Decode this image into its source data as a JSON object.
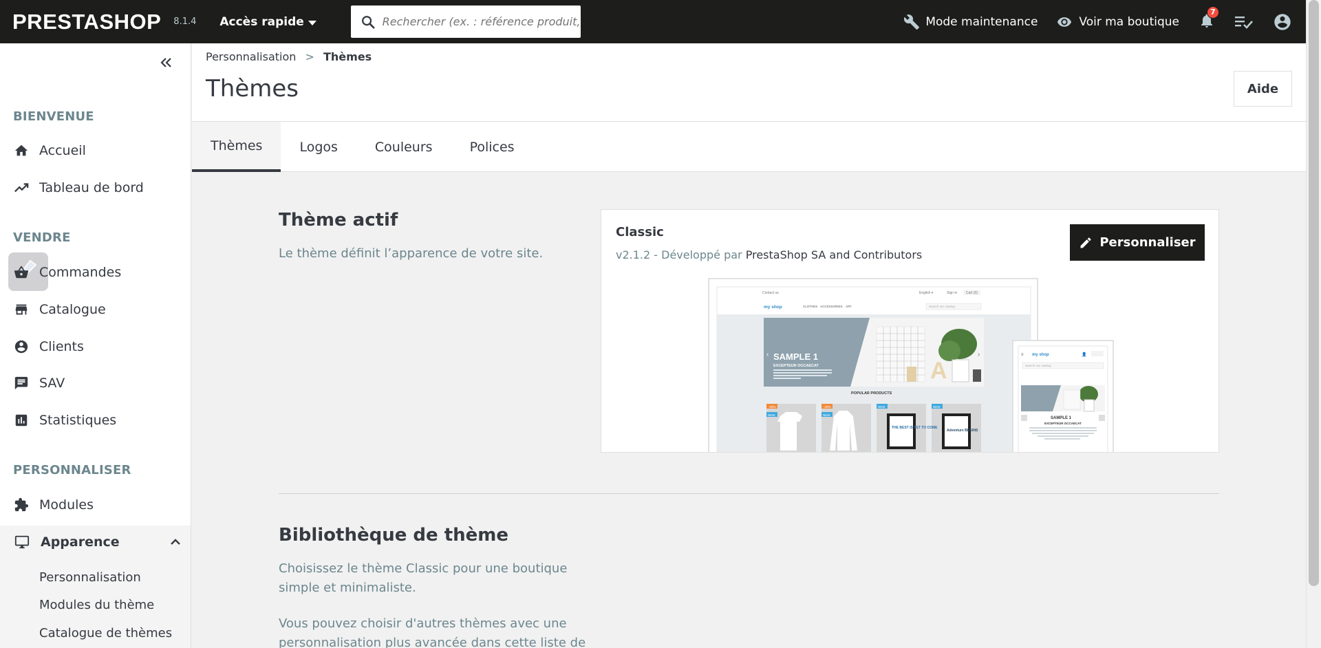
{
  "header": {
    "logo": "PRESTASHOP",
    "version": "8.1.4",
    "quick_access": "Accès rapide",
    "search_placeholder": "Rechercher (ex. : référence produit, no",
    "maintenance": "Mode maintenance",
    "view_shop": "Voir ma boutique",
    "notifications_count": "7"
  },
  "sidebar": {
    "sections": {
      "welcome": "BIENVENUE",
      "sell": "VENDRE",
      "customize": "PERSONNALISER"
    },
    "items": {
      "home": "Accueil",
      "dashboard": "Tableau de bord",
      "orders": "Commandes",
      "catalog": "Catalogue",
      "customers": "Clients",
      "support": "SAV",
      "stats": "Statistiques",
      "modules": "Modules",
      "appearance": "Apparence"
    },
    "subitems": {
      "personalization": "Personnalisation",
      "theme_modules": "Modules du thème",
      "theme_catalog": "Catalogue de thèmes"
    }
  },
  "breadcrumb": {
    "parent": "Personnalisation",
    "separator": ">",
    "current": "Thèmes"
  },
  "page": {
    "title": "Thèmes",
    "help": "Aide"
  },
  "tabs": [
    "Thèmes",
    "Logos",
    "Couleurs",
    "Polices"
  ],
  "active_theme": {
    "heading": "Thème actif",
    "description": "Le thème définit l’apparence de votre site.",
    "name": "Classic",
    "meta_prefix": "v2.1.2 - Développé par",
    "author": "PrestaShop SA and Contributors",
    "customize_button": "Personnaliser"
  },
  "preview": {
    "contact": "Contact us",
    "language": "English ▾",
    "sign_in": "Sign in",
    "cart": "Cart (0)",
    "shop_name": "my shop",
    "nav": [
      "CLOTHES",
      "ACCESSORIES",
      "ART"
    ],
    "search": "Search our catalog",
    "slide_title": "SAMPLE 1",
    "slide_subtitle": "EXCEPTEUR OCCAECAT",
    "slide_text": "Lorem ipsum dolor sit amet, consectetur adipiscing elit. Proin tristique in tortor et dignissim. Quisque non tempor leo. Maecenas egestas sem elit.",
    "popular": "POPULAR PRODUCTS",
    "tags": [
      "-20%",
      "-20%",
      "NEW",
      "NEW"
    ],
    "tags2": [
      "NEW",
      "NEW"
    ],
    "poster1": "THE BEST IS YET TO COME",
    "poster2": "Adventure BEGINS",
    "mobile_slide_title": "SAMPLE 1",
    "mobile_slide_subtitle": "EXCEPTEUR OCCAECAT",
    "mobile_text": "Lorem ipsum dolor sit amet, consectetur adipiscing elit. Proin tristique in tortor et dignissim. Quisque non tempor leo. Maecenas egestas sem elit."
  },
  "library": {
    "heading": "Bibliothèque de thème",
    "p1_line1": "Choisissez le thème Classic pour une boutique",
    "p1_line2": "simple et minimaliste.",
    "p2_line1": "Vous pouvez choisir d'autres thèmes avec une",
    "p2_line2": "personnalisation plus avancée dans cette liste de"
  },
  "colors": {
    "header_bg": "#1d1d1b",
    "accent": "#25b9d7",
    "notif": "#f54c3e",
    "text": "#363a41",
    "muted": "#6c868e"
  }
}
